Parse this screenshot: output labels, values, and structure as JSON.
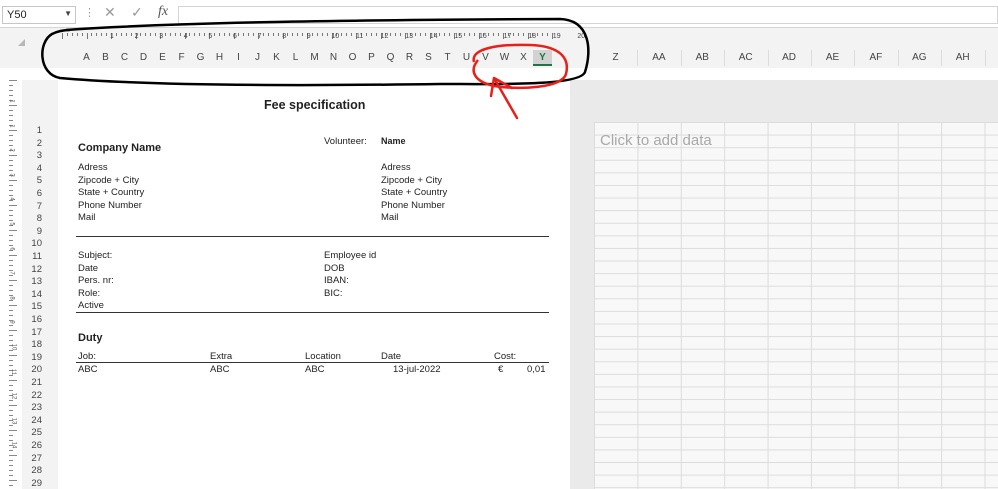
{
  "formula_bar": {
    "name_box": "Y50",
    "cancel_icon": "✕",
    "enter_icon": "✓",
    "fx_label": "fx",
    "formula_value": ""
  },
  "ruler_numbers": [
    "1",
    "2",
    "3",
    "4",
    "5",
    "6",
    "7",
    "8",
    "9",
    "10",
    "11",
    "12",
    "13",
    "14",
    "15",
    "16",
    "17",
    "18",
    "19",
    "20"
  ],
  "columns": [
    "A",
    "B",
    "C",
    "D",
    "E",
    "F",
    "G",
    "H",
    "I",
    "J",
    "K",
    "L",
    "M",
    "N",
    "O",
    "P",
    "Q",
    "R",
    "S",
    "T",
    "U",
    "V",
    "W",
    "X",
    "Y"
  ],
  "selected_column": "Y",
  "right_columns": [
    "Z",
    "AA",
    "AB",
    "AC",
    "AD",
    "AE",
    "AF",
    "AG",
    "AH"
  ],
  "rows": [
    "1",
    "2",
    "3",
    "4",
    "5",
    "6",
    "7",
    "8",
    "9",
    "10",
    "11",
    "12",
    "13",
    "14",
    "15",
    "16",
    "17",
    "18",
    "19",
    "20",
    "21",
    "22",
    "23",
    "24",
    "25",
    "26",
    "27",
    "28",
    "29"
  ],
  "vruler_numbers": [
    "1",
    "1",
    "2",
    "3",
    "4",
    "5",
    "6",
    "7",
    "8",
    "9",
    "10",
    "11",
    "12",
    "13",
    "14"
  ],
  "click_to_add": "Click to add data",
  "sheet": {
    "title": "Fee specification",
    "company_name": "Company Name",
    "volunteer_label": "Volunteer:",
    "volunteer_name": "Name",
    "left_address": [
      "Adress",
      "Zipcode + City",
      "State + Country",
      "Phone Number",
      "Mail"
    ],
    "right_address": [
      "Adress",
      "Zipcode + City",
      "State + Country",
      "Phone Number",
      "Mail"
    ],
    "left_fields": [
      "Subject:",
      "Date",
      "Pers. nr:",
      "Role:",
      "Active"
    ],
    "right_fields": [
      "Employee id",
      "DOB",
      "IBAN:",
      "BIC:"
    ],
    "duty_title": "Duty",
    "duty_headers": {
      "job": "Job:",
      "extra": "Extra",
      "location": "Location",
      "date": "Date",
      "cost": "Cost:"
    },
    "duty_row": {
      "job": "ABC",
      "extra": "ABC",
      "location": "ABC",
      "date": "13-jul-2022",
      "currency": "€",
      "cost": "0,01"
    }
  },
  "colors": {
    "annotation_black": "#000000",
    "annotation_red": "#e8201a",
    "selected_accent": "#217346"
  }
}
